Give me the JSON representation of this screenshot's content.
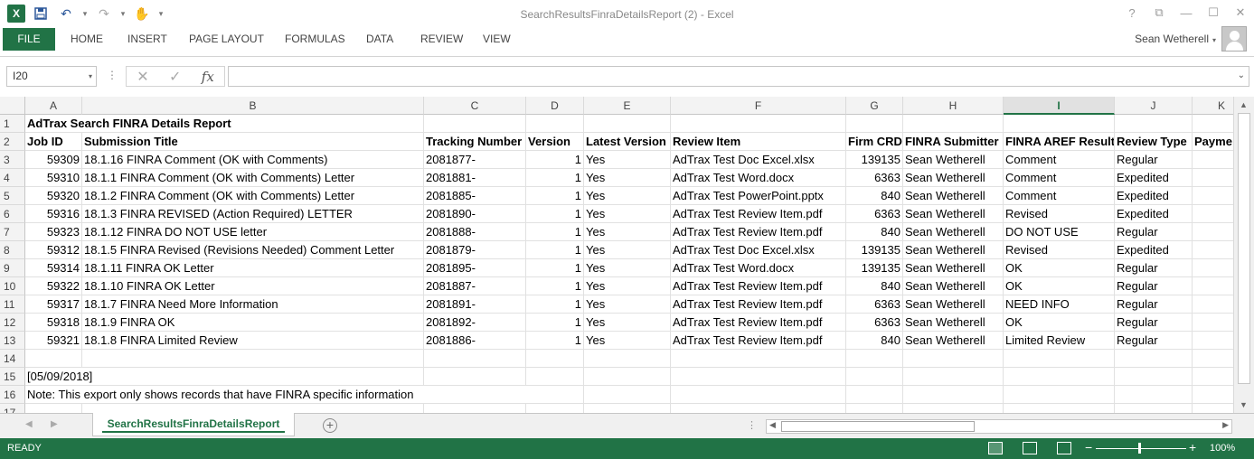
{
  "window": {
    "title": "SearchResultsFinraDetailsReport (2) - Excel",
    "controls": [
      "?",
      "⧉",
      "—",
      "☐",
      "✕"
    ]
  },
  "ribbon": {
    "tabs": [
      "FILE",
      "HOME",
      "INSERT",
      "PAGE LAYOUT",
      "FORMULAS",
      "DATA",
      "REVIEW",
      "VIEW"
    ],
    "user": "Sean Wetherell"
  },
  "formula_bar": {
    "name_box": "I20",
    "fx": "fx",
    "value": ""
  },
  "columns": [
    "A",
    "B",
    "C",
    "D",
    "E",
    "F",
    "G",
    "H",
    "I",
    "J",
    "K"
  ],
  "selected_column": "I",
  "rows": [
    "1",
    "2",
    "3",
    "4",
    "5",
    "6",
    "7",
    "8",
    "9",
    "10",
    "11",
    "12",
    "13",
    "14",
    "15",
    "16",
    "17"
  ],
  "report": {
    "title": "AdTrax Search FINRA Details Report",
    "headers": [
      "Job ID",
      "Submission Title",
      "Tracking Number",
      "Version",
      "Latest Version",
      "Review Item",
      "Firm CRD",
      "FINRA Submitter",
      "FINRA AREF Result",
      "Review Type",
      "Payme"
    ],
    "data": [
      [
        "59309",
        "18.1.16 FINRA Comment (OK with Comments)",
        "2081877-",
        "1",
        "Yes",
        "AdTrax Test Doc Excel.xlsx",
        "139135",
        "Sean Wetherell",
        "Comment",
        "Regular"
      ],
      [
        "59310",
        "18.1.1 FINRA Comment (OK with Comments) Letter",
        "2081881-",
        "1",
        "Yes",
        "AdTrax Test Word.docx",
        "6363",
        "Sean Wetherell",
        "Comment",
        "Expedited"
      ],
      [
        "59320",
        "18.1.2 FINRA Comment (OK with Comments) Letter",
        "2081885-",
        "1",
        "Yes",
        "AdTrax Test PowerPoint.pptx",
        "840",
        "Sean Wetherell",
        "Comment",
        "Expedited"
      ],
      [
        "59316",
        "18.1.3 FINRA REVISED (Action Required) LETTER",
        "2081890-",
        "1",
        "Yes",
        "AdTrax Test Review Item.pdf",
        "6363",
        "Sean Wetherell",
        "Revised",
        "Expedited"
      ],
      [
        "59323",
        "18.1.12 FINRA DO NOT USE letter",
        "2081888-",
        "1",
        "Yes",
        "AdTrax Test Review Item.pdf",
        "840",
        "Sean Wetherell",
        "DO NOT USE",
        "Regular"
      ],
      [
        "59312",
        "18.1.5 FINRA Revised (Revisions Needed) Comment Letter",
        "2081879-",
        "1",
        "Yes",
        "AdTrax Test Doc Excel.xlsx",
        "139135",
        "Sean Wetherell",
        "Revised",
        "Expedited"
      ],
      [
        "59314",
        "18.1.11 FINRA OK Letter",
        "2081895-",
        "1",
        "Yes",
        "AdTrax Test Word.docx",
        "139135",
        "Sean Wetherell",
        "OK",
        "Regular"
      ],
      [
        "59322",
        "18.1.10 FINRA OK Letter",
        "2081887-",
        "1",
        "Yes",
        "AdTrax Test Review Item.pdf",
        "840",
        "Sean Wetherell",
        "OK",
        "Regular"
      ],
      [
        "59317",
        "18.1.7 FINRA Need More Information",
        "2081891-",
        "1",
        "Yes",
        "AdTrax Test Review Item.pdf",
        "6363",
        "Sean Wetherell",
        "NEED INFO",
        "Regular"
      ],
      [
        "59318",
        "18.1.9 FINRA OK",
        "2081892-",
        "1",
        "Yes",
        "AdTrax Test Review Item.pdf",
        "6363",
        "Sean Wetherell",
        "OK",
        "Regular"
      ],
      [
        "59321",
        "18.1.8 FINRA Limited Review",
        "2081886-",
        "1",
        "Yes",
        "AdTrax Test Review Item.pdf",
        "840",
        "Sean Wetherell",
        "Limited Review",
        "Regular"
      ]
    ],
    "date": "[05/09/2018]",
    "note": "Note: This export only shows records that have FINRA specific information"
  },
  "sheet_tabs": [
    "SearchResultsFinraDetailsReport"
  ],
  "status": {
    "text": "READY",
    "zoom": "100%"
  }
}
